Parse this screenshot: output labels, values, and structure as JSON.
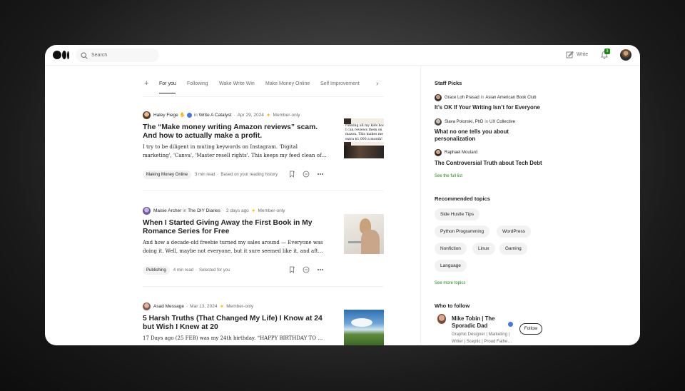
{
  "header": {
    "search_placeholder": "Search",
    "write_label": "Write",
    "notification_count": "3"
  },
  "tabs": [
    "For you",
    "Following",
    "Wake Write Win",
    "Make Money Online",
    "Self Improvement"
  ],
  "articles": [
    {
      "author": "Haley Fiege",
      "in_label": "in",
      "publication": "Write A Catalyst",
      "date": "Apr 29, 2024",
      "member": "Member-only",
      "title": "The “Make money writing Amazon reviews” scam. And how to actually make a profit.",
      "excerpt1": "I try to be diligent in muting keywords on Instagram. 'Digital",
      "excerpt2": "marketing', 'Canva', 'Master resell rights'. This keeps my feed clean of…",
      "tag": "Making Money Online",
      "read_time": "3 min read",
      "reason": "Based on your reading history",
      "thumb_text": "running all my kids book\nI can reviews them on\nmazon. This makes me\nextra $1,000 a month!"
    },
    {
      "author": "Maisie Archer",
      "in_label": "in",
      "publication": "The DIY Diaries",
      "date": "2 days ago",
      "member": "Member-only",
      "title": "When I Started Giving Away the First Book in My Romance Series for Free",
      "excerpt1": "And how a decade-old freebie turned my sales around — Everyone was",
      "excerpt2": "doing it. Well, maybe not everyone, but it sure seemed like it, and aft…",
      "tag": "Publishing",
      "read_time": "4 min read",
      "reason": "Selected for you"
    },
    {
      "author": "Asad Message",
      "date": "Mar 13, 2024",
      "member": "Member-only",
      "title": "5 Harsh Truths (That Changed My Life) I Know at 24 but Wish I Knew at 20",
      "excerpt1": "17 Days ago (25 FEB) was my 24th birthday. “HAPPY BIRTHDAY TO ME”"
    }
  ],
  "sidebar": {
    "staff_picks_title": "Staff Picks",
    "picks": [
      {
        "author": "Grace Loh Prasad",
        "in_label": "in",
        "publication": "Asian American Book Club",
        "title": "It’s OK If Your Writing Isn’t for Everyone"
      },
      {
        "author": "Slava Polonski, PhD",
        "in_label": "in",
        "publication": "UX Collective",
        "title": "What no one tells you about personalization"
      },
      {
        "author": "Raphael Moutard",
        "title": "The Controversial Truth about Tech Debt"
      }
    ],
    "see_full_list": "See the full list",
    "recommended_title": "Recommended topics",
    "topics": [
      "Side Hustle Tips",
      "Python Programming",
      "WordPress",
      "Nonfiction",
      "Linux",
      "Gaming",
      "Language"
    ],
    "see_more_topics": "See more topics",
    "who_to_follow_title": "Who to follow",
    "follow": {
      "name": "Mike Tobin | The Sporadic Dad",
      "bio": "Graphic Designer | Marketing | Writer | Sceptic | Proud Fathe…",
      "button": "Follow"
    }
  },
  "colors": {
    "accent_green": "#1a8917",
    "star_yellow": "#ffc017",
    "verified_blue": "#4376e6",
    "text": "#242424",
    "muted": "#6b6b6b"
  }
}
